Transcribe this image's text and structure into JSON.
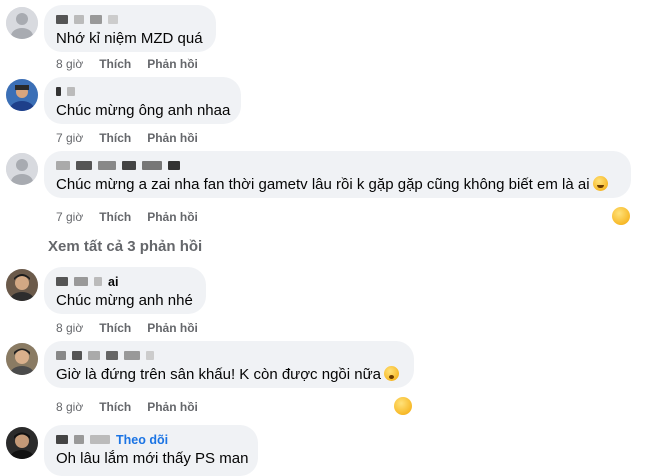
{
  "comments": [
    {
      "name": "",
      "text": "Nhớ kỉ niệm MZD quá",
      "time": "8 giờ",
      "like": "Thích",
      "reply": "Phản hồi"
    },
    {
      "name": "",
      "text": "Chúc mừng ông anh nhaa",
      "time": "7 giờ",
      "like": "Thích",
      "reply": "Phản hồi"
    },
    {
      "name": "",
      "text": "Chúc mừng a zai nha fan thời gametv lâu rồi k gặp gặp cũng không biết em là ai",
      "time": "7 giờ",
      "like": "Thích",
      "reply": "Phản hồi",
      "reaction": "haha-icon"
    },
    {
      "name": "ai",
      "text": "Chúc mừng anh nhé",
      "time": "8 giờ",
      "like": "Thích",
      "reply": "Phản hồi"
    },
    {
      "name": "",
      "text": "Giờ là đứng trên sân khấu! K còn được ngồi nữa",
      "time": "8 giờ",
      "like": "Thích",
      "reply": "Phản hồi",
      "reaction": "haha-icon"
    },
    {
      "name": "",
      "follow": "Theo dõi",
      "text": "Oh lâu lắm mới thấy PS man"
    }
  ],
  "see_all": "Xem tất cả 3 phản hồi",
  "colors": {
    "bubble": "#f0f2f5",
    "meta": "#65676b",
    "link": "#1b74e4"
  }
}
